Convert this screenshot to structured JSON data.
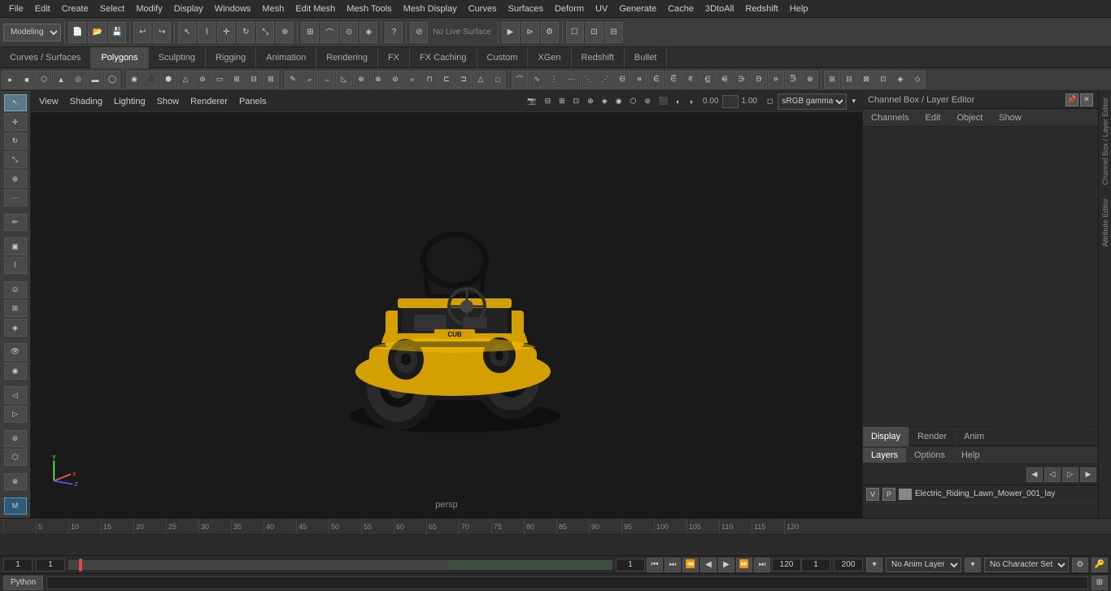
{
  "app": {
    "title": "Autodesk Maya"
  },
  "menu": {
    "items": [
      "File",
      "Edit",
      "Create",
      "Select",
      "Modify",
      "Display",
      "Windows",
      "Mesh",
      "Edit Mesh",
      "Mesh Tools",
      "Mesh Display",
      "Curves",
      "Surfaces",
      "Deform",
      "UV",
      "Generate",
      "Cache",
      "3DtoAll",
      "Redshift",
      "Help"
    ]
  },
  "toolbar": {
    "workspace_label": "Modeling",
    "live_surface_label": "No Live Surface"
  },
  "tabs": {
    "items": [
      "Curves / Surfaces",
      "Polygons",
      "Sculpting",
      "Rigging",
      "Animation",
      "Rendering",
      "FX",
      "FX Caching",
      "Custom",
      "XGen",
      "Redshift",
      "Bullet"
    ],
    "active": "Polygons"
  },
  "viewport": {
    "label": "persp",
    "menus": [
      "View",
      "Shading",
      "Lighting",
      "Show",
      "Renderer",
      "Panels"
    ],
    "gamma": "sRGB gamma",
    "camera_near": "0.00",
    "camera_far": "1.00"
  },
  "channel_box": {
    "title": "Channel Box / Layer Editor",
    "tabs": [
      "Channels",
      "Edit",
      "Object",
      "Show"
    ],
    "display_tabs": [
      "Display",
      "Render",
      "Anim"
    ],
    "active_display_tab": "Display",
    "layer_section": {
      "tabs": [
        "Layers",
        "Options",
        "Help"
      ],
      "active_tab": "Layers",
      "layer_row": {
        "v": "V",
        "p": "P",
        "name": "Electric_Riding_Lawn_Mower_001_lay"
      }
    }
  },
  "right_strip": {
    "labels": [
      "Channel Box / Layer Editor",
      "Attribute Editor"
    ]
  },
  "timeline": {
    "ticks": [
      "",
      "5",
      "10",
      "15",
      "20",
      "25",
      "30",
      "35",
      "40",
      "45",
      "50",
      "55",
      "60",
      "65",
      "70",
      "75",
      "80",
      "85",
      "90",
      "95",
      "100",
      "105",
      "110",
      "115",
      "120"
    ]
  },
  "playback": {
    "current_frame_left": "1",
    "current_frame_right": "1",
    "frame_display": "1",
    "range_start": "1",
    "range_end": "120",
    "range_start2": "120",
    "range_end2": "200",
    "anim_layer": "No Anim Layer",
    "char_set": "No Character Set",
    "buttons": [
      "⏮",
      "⏭",
      "⏪",
      "◀",
      "▶",
      "⏩",
      "⏭"
    ]
  },
  "status_bar": {
    "python_label": "Python",
    "command_placeholder": ""
  },
  "icons": {
    "select": "↖",
    "move": "✛",
    "rotate": "↻",
    "scale": "⤡",
    "snap": "⊙",
    "universal": "⊕",
    "soft": "⋯",
    "paint": "✏",
    "marquee": "▣",
    "lasso": "⌇",
    "axis_x": "X",
    "axis_y": "Y",
    "axis_z": "Z"
  }
}
